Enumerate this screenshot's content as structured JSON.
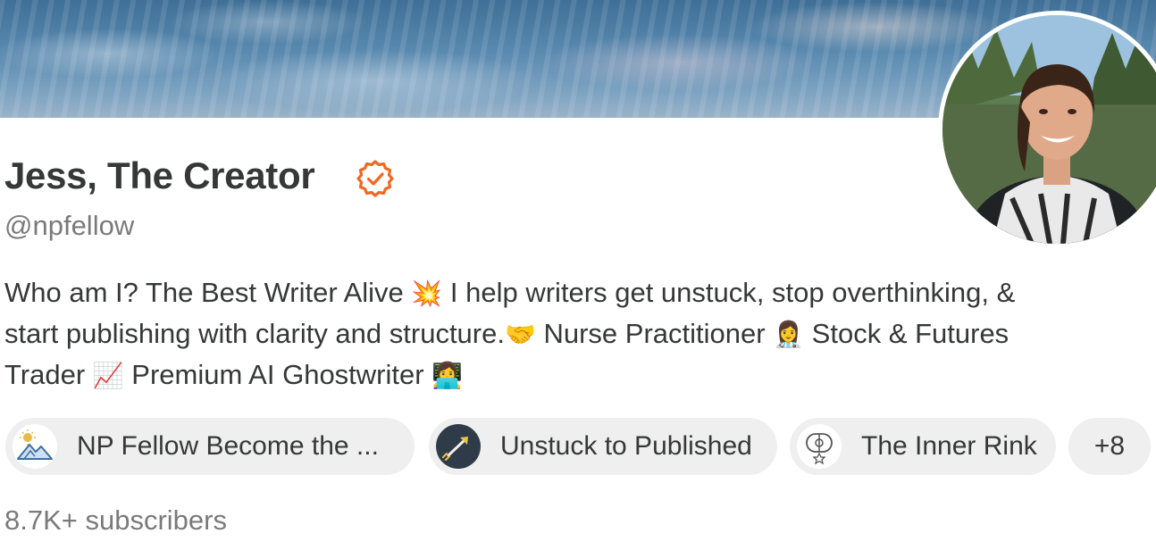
{
  "profile": {
    "name": "Jess, The Creator",
    "handle": "@npfellow",
    "bio_lines": [
      {
        "text_a": "Who am I? The Best Writer Alive ",
        "emoji_a": "💥",
        "text_b": " I help writers get unstuck, stop overthinking, &",
        "emoji_b": ""
      },
      {
        "text_a": "start publishing with clarity and structure.",
        "emoji_a": "🤝",
        "text_b": " Nurse Practitioner ",
        "emoji_b": "👩‍⚕️",
        "text_c": " Stock & Futures"
      },
      {
        "text_a": "Trader ",
        "emoji_a": "📈",
        "text_b": " Premium AI Ghostwriter ",
        "emoji_b": "👩‍💻"
      }
    ],
    "subscribers": "8.7K+ subscribers"
  },
  "publications": [
    {
      "label": "NP Fellow Become the ...",
      "icon": "mountain-sun-icon"
    },
    {
      "label": "Unstuck to Published",
      "icon": "rocket-arrow-icon"
    },
    {
      "label": "The Inner Rink",
      "icon": "rink-icon"
    }
  ],
  "more_publications": "+8",
  "colors": {
    "accent": "#f26722",
    "text": "#363737",
    "muted": "#7a7a7a",
    "pill_bg": "#efefef"
  },
  "icons": {
    "verified": "verified-badge-icon"
  }
}
